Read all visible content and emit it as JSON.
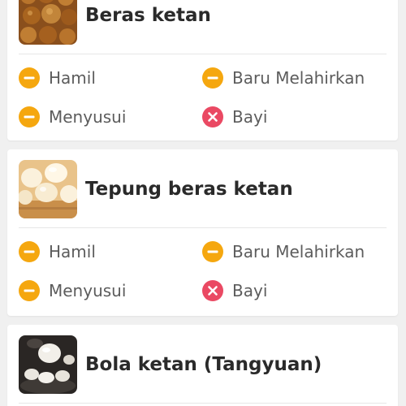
{
  "colors": {
    "caution": "#f5a70f",
    "avoid": "#ea4963",
    "card_bg": "#ffffff",
    "page_bg": "#f0f0f0"
  },
  "foods": [
    {
      "name": "Beras ketan",
      "image_icon": "sticky-rice-cake-photo",
      "statuses": [
        {
          "label": "Hamil",
          "icon": "minus-circle-icon",
          "level": "caution"
        },
        {
          "label": "Baru Melahirkan",
          "icon": "minus-circle-icon",
          "level": "caution"
        },
        {
          "label": "Menyusui",
          "icon": "minus-circle-icon",
          "level": "caution"
        },
        {
          "label": "Bayi",
          "icon": "cross-circle-icon",
          "level": "avoid"
        }
      ]
    },
    {
      "name": "Tepung beras ketan",
      "image_icon": "rice-flour-balls-photo",
      "statuses": [
        {
          "label": "Hamil",
          "icon": "minus-circle-icon",
          "level": "caution"
        },
        {
          "label": "Baru Melahirkan",
          "icon": "minus-circle-icon",
          "level": "caution"
        },
        {
          "label": "Menyusui",
          "icon": "minus-circle-icon",
          "level": "caution"
        },
        {
          "label": "Bayi",
          "icon": "cross-circle-icon",
          "level": "avoid"
        }
      ]
    },
    {
      "name": "Bola ketan (Tangyuan)",
      "image_icon": "tangyuan-photo"
    }
  ]
}
